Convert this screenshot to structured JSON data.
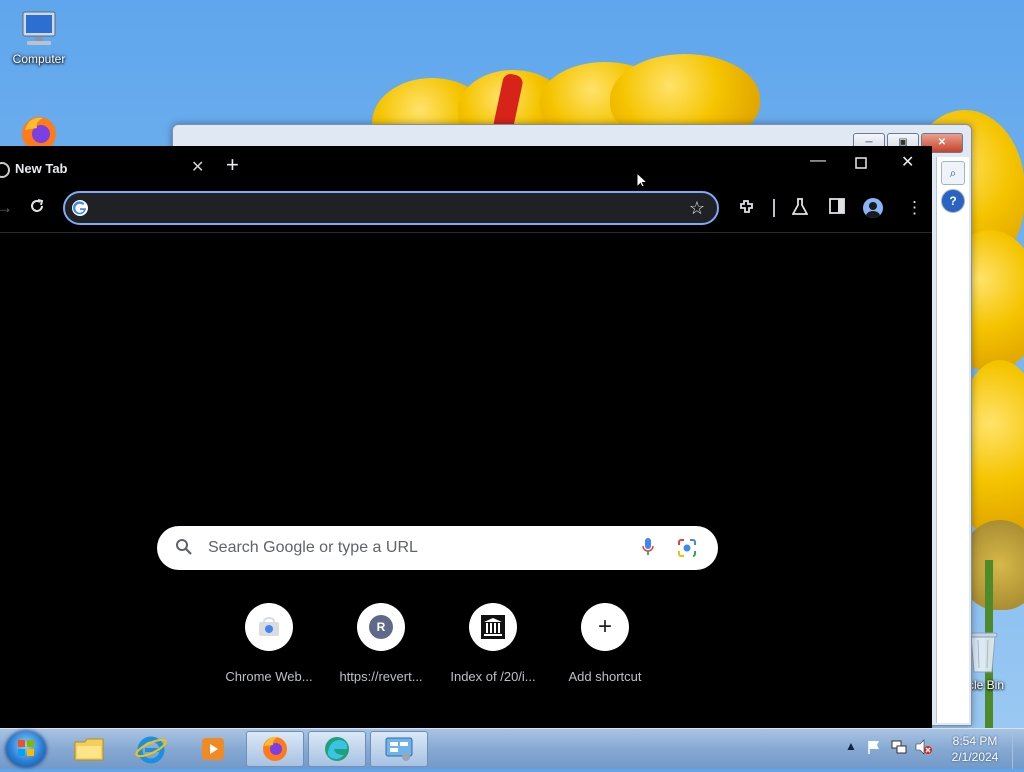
{
  "desktop": {
    "icons": [
      {
        "label": "Computer",
        "icon": "computer-icon"
      },
      {
        "label": "",
        "icon": "firefox-icon"
      },
      {
        "label": "cle Bin",
        "icon": "recycle-bin-icon"
      }
    ]
  },
  "chrome": {
    "tab": {
      "title": "New Tab",
      "close": "✕"
    },
    "new_tab": "+",
    "window_controls": {
      "minimize": "—",
      "maximize": "☐",
      "close": "✕"
    },
    "omnibox": {
      "value": "",
      "placeholder": ""
    },
    "search": {
      "placeholder": "Search Google or type a URL"
    },
    "shortcuts": [
      {
        "label": "Chrome Web...",
        "glyph": "",
        "icon": "chrome-web-store-icon"
      },
      {
        "label": "https://revert...",
        "glyph": "R",
        "icon": "letter-r-icon"
      },
      {
        "label": "Index of /20/i...",
        "glyph": "🏛",
        "icon": "museum-icon"
      },
      {
        "label": "Add shortcut",
        "glyph": "+",
        "icon": "plus-icon"
      }
    ],
    "colors": {
      "accent": "#7cacf8",
      "background": "#000000",
      "text": "#e8eaed"
    }
  },
  "taskbar": {
    "clock": {
      "time": "8:54 PM",
      "date": "2/1/2024"
    },
    "apps": [
      "start-icon",
      "file-explorer-icon",
      "internet-explorer-icon",
      "media-player-icon",
      "firefox-icon",
      "edge-icon",
      "control-panel-icon"
    ]
  }
}
